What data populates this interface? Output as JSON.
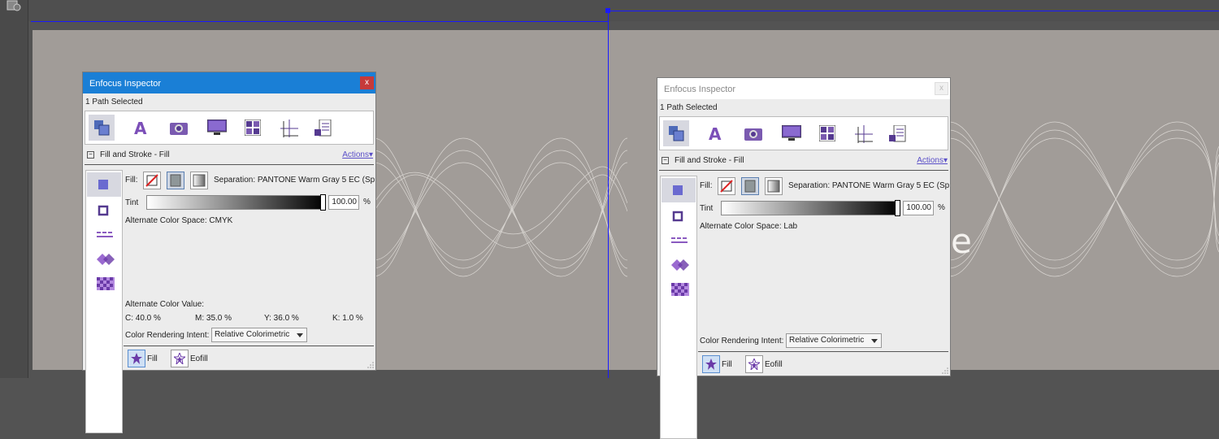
{
  "window_title": "Enfocus Inspector",
  "close_glyph": "x",
  "selection_status": "1 Path Selected",
  "section_title": "Fill and Stroke - Fill",
  "section_toggle": "−",
  "actions_label": "Actions▾",
  "fill_label": "Fill:",
  "separation": "Separation: PANTONE Warm Gray 5 EC (Sp...",
  "tint_label": "Tint",
  "tint_value": "100.00",
  "percent_sign": "%",
  "color_rendering_label": "Color Rendering Intent:",
  "color_rendering_value": "Relative Colorimetric",
  "fill_rule_label": "Fill",
  "eofill_label": "Eofill",
  "toolbar_icons": [
    "object-icon",
    "text-icon",
    "camera-icon",
    "monitor-icon",
    "grid-icon",
    "move-icon",
    "document-icon"
  ],
  "side_icons": [
    "fill-square-icon",
    "stroke-square-icon",
    "dash-icon",
    "diamond-icon",
    "pattern-icon"
  ],
  "panels": [
    {
      "alt_color_space": "Alternate Color Space:  CMYK",
      "alt_color_value_label": "Alternate Color Value:",
      "cmyk": {
        "c": "C:  40.0   %",
        "m": "M:  35.0   %",
        "y": "Y:  36.0   %",
        "k": "K:   1.0   %"
      }
    },
    {
      "alt_color_space": "Alternate Color Space:  Lab"
    }
  ],
  "canvas_text": "e",
  "colors": {
    "accent_blue": "#1a7fd6",
    "guide": "#1a1aff",
    "close_red": "#c63a3a",
    "icon_purple": "#6a3aa8",
    "page_gray": "#a19c98"
  }
}
